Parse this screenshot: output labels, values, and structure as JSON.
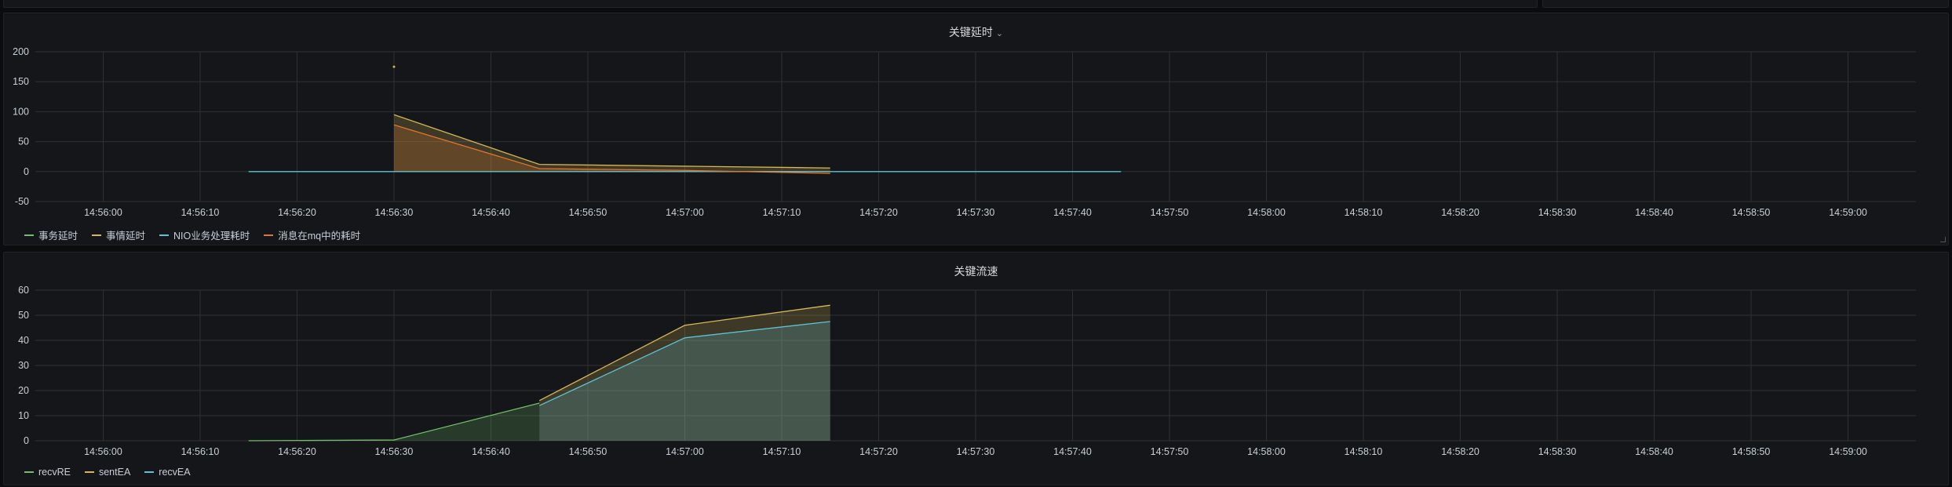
{
  "panels": {
    "latency": {
      "title": "关键延时",
      "chevron": "⌄"
    },
    "throughput": {
      "title": "关键流速"
    }
  },
  "icons": {
    "resize": "resize-handle-icon"
  },
  "chart_data": [
    {
      "type": "area",
      "title": "关键延时",
      "x_ticks": [
        "14:56:00",
        "14:56:10",
        "14:56:20",
        "14:56:30",
        "14:56:40",
        "14:56:50",
        "14:57:00",
        "14:57:10",
        "14:57:20",
        "14:57:30",
        "14:57:40",
        "14:57:50",
        "14:58:00",
        "14:58:10",
        "14:58:20",
        "14:58:30",
        "14:58:40",
        "14:58:50",
        "14:59:00"
      ],
      "y_ticks": [
        200,
        150,
        100,
        50,
        0,
        -50
      ],
      "ylim": [
        -50,
        200
      ],
      "xlim": [
        "14:55:53",
        "14:59:07"
      ],
      "grid": true,
      "legend_position": "bottom-left",
      "series": [
        {
          "name": "事务延时",
          "color": "#73bf69",
          "fill": false,
          "points": [
            [
              "14:56:30",
              0
            ],
            [
              "14:56:45",
              0
            ],
            [
              "14:57:00",
              0
            ],
            [
              "14:57:15",
              0
            ]
          ]
        },
        {
          "name": "事情延时",
          "color": "#d6b656",
          "fill": true,
          "points": [
            [
              "14:56:30",
              95
            ],
            [
              "14:56:45",
              12
            ],
            [
              "14:57:00",
              9
            ],
            [
              "14:57:15",
              6
            ]
          ]
        },
        {
          "name": "NIO业务处理耗时",
          "color": "#5ec1d6",
          "fill": false,
          "points": [
            [
              "14:56:15",
              0
            ],
            [
              "14:56:30",
              0
            ],
            [
              "14:56:45",
              0
            ],
            [
              "14:57:00",
              0
            ],
            [
              "14:57:15",
              0
            ],
            [
              "14:57:30",
              0
            ],
            [
              "14:57:45",
              0
            ]
          ]
        },
        {
          "name": "消息在mq中的耗时",
          "color": "#e0752d",
          "fill": true,
          "points": [
            [
              "14:56:30",
              78
            ],
            [
              "14:56:45",
              5
            ],
            [
              "14:57:00",
              2
            ],
            [
              "14:57:15",
              -3
            ]
          ]
        }
      ],
      "outlier_point": [
        "14:56:30",
        175
      ]
    },
    {
      "type": "area",
      "title": "关键流速",
      "x_ticks": [
        "14:56:00",
        "14:56:10",
        "14:56:20",
        "14:56:30",
        "14:56:40",
        "14:56:50",
        "14:57:00",
        "14:57:10",
        "14:57:20",
        "14:57:30",
        "14:57:40",
        "14:57:50",
        "14:58:00",
        "14:58:10",
        "14:58:20",
        "14:58:30",
        "14:58:40",
        "14:58:50",
        "14:59:00"
      ],
      "y_ticks": [
        60,
        50,
        40,
        30,
        20,
        10,
        0
      ],
      "ylim": [
        0,
        60
      ],
      "xlim": [
        "14:55:53",
        "14:59:07"
      ],
      "grid": true,
      "legend_position": "bottom-left",
      "series": [
        {
          "name": "recvRE",
          "color": "#73bf69",
          "fill": true,
          "points": [
            [
              "14:56:15",
              0
            ],
            [
              "14:56:30",
              0.3
            ],
            [
              "14:56:45",
              15
            ]
          ]
        },
        {
          "name": "sentEA",
          "color": "#d6b656",
          "fill": true,
          "points": [
            [
              "14:56:45",
              16
            ],
            [
              "14:57:00",
              46
            ],
            [
              "14:57:15",
              54
            ]
          ]
        },
        {
          "name": "recvEA",
          "color": "#5ec1d6",
          "fill": true,
          "points": [
            [
              "14:56:45",
              14
            ],
            [
              "14:57:00",
              41
            ],
            [
              "14:57:15",
              47.5
            ]
          ]
        }
      ]
    }
  ]
}
